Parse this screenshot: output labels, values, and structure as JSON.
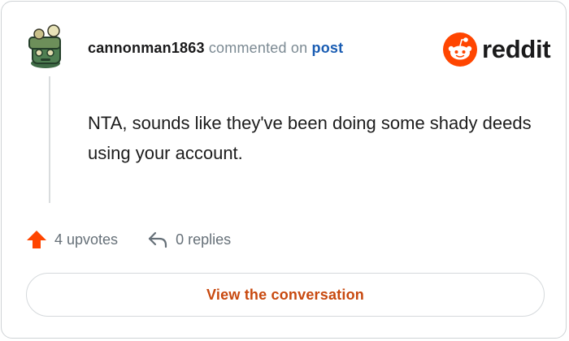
{
  "comment": {
    "username": "cannonman1863",
    "action_text": "commented on",
    "target_link": "post",
    "body": "NTA, sounds like they've been doing some shady deeds using your account."
  },
  "brand": {
    "wordmark": "reddit",
    "accent_color": "#ff4500"
  },
  "stats": {
    "upvotes": "4 upvotes",
    "replies": "0 replies"
  },
  "cta": {
    "label": "View the conversation",
    "color": "#c8490f"
  },
  "icons": {
    "avatar": "user-avatar",
    "logo": "reddit-snoo-icon",
    "upvote": "upvote-arrow-icon",
    "reply": "reply-arrow-icon"
  }
}
